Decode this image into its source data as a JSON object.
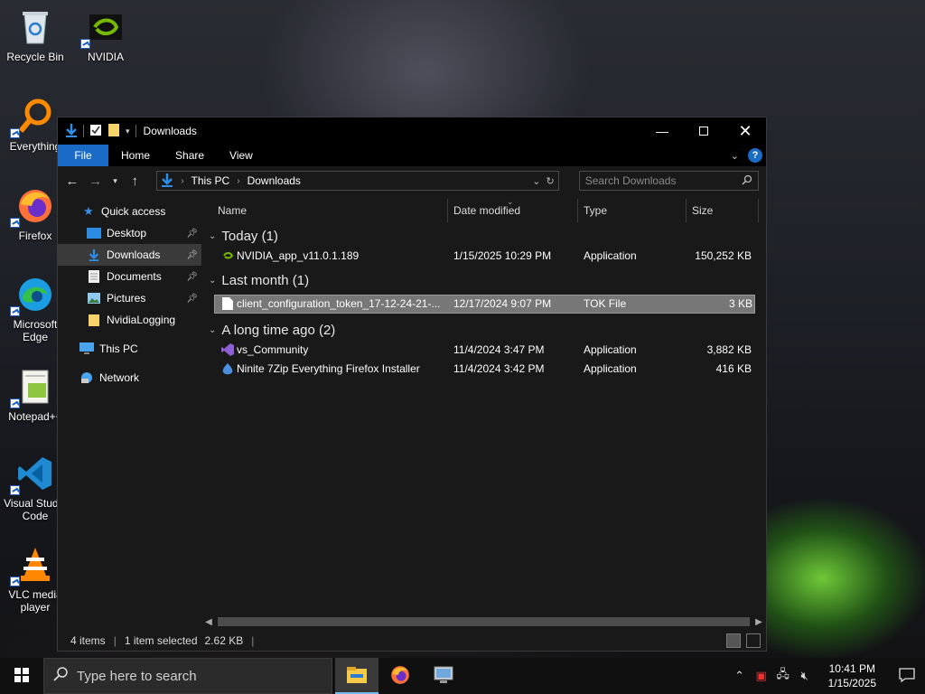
{
  "desktop": {
    "icons": [
      {
        "label": "Recycle Bin"
      },
      {
        "label": "NVIDIA"
      },
      {
        "label": "Everything"
      },
      {
        "label": "Firefox"
      },
      {
        "label": "Microsoft Edge"
      },
      {
        "label": "Notepad++"
      },
      {
        "label": "Visual Studio Code"
      },
      {
        "label": "VLC media player"
      }
    ]
  },
  "window": {
    "title": "Downloads",
    "ribbon": {
      "tabs": [
        "File",
        "Home",
        "Share",
        "View"
      ]
    },
    "address": {
      "segments": [
        "This PC",
        "Downloads"
      ]
    },
    "search": {
      "placeholder": "Search Downloads"
    },
    "nav": {
      "items": [
        {
          "label": "Quick access"
        },
        {
          "label": "Desktop"
        },
        {
          "label": "Downloads"
        },
        {
          "label": "Documents"
        },
        {
          "label": "Pictures"
        },
        {
          "label": "NvidiaLogging"
        },
        {
          "label": "This PC"
        },
        {
          "label": "Network"
        }
      ]
    },
    "columns": [
      "Name",
      "Date modified",
      "Type",
      "Size"
    ],
    "groups": [
      {
        "label": "Today (1)",
        "files": [
          {
            "name": "NVIDIA_app_v11.0.1.189",
            "date": "1/15/2025 10:29 PM",
            "type": "Application",
            "size": "150,252 KB"
          }
        ]
      },
      {
        "label": "Last month (1)",
        "files": [
          {
            "name": "client_configuration_token_17-12-24-21-...",
            "date": "12/17/2024 9:07 PM",
            "type": "TOK File",
            "size": "3 KB"
          }
        ]
      },
      {
        "label": "A long time ago (2)",
        "files": [
          {
            "name": "vs_Community",
            "date": "11/4/2024 3:47 PM",
            "type": "Application",
            "size": "3,882 KB"
          },
          {
            "name": "Ninite 7Zip Everything Firefox Installer",
            "date": "11/4/2024 3:42 PM",
            "type": "Application",
            "size": "416 KB"
          }
        ]
      }
    ],
    "status": {
      "items": "4 items",
      "selected": "1 item selected",
      "size": "2.62 KB"
    }
  },
  "taskbar": {
    "search_placeholder": "Type here to search",
    "clock": {
      "time": "10:41 PM",
      "date": "1/15/2025"
    }
  },
  "colors": {
    "accent": "#1a6bc6",
    "selection": "#777777",
    "window_bg": "#191919"
  }
}
